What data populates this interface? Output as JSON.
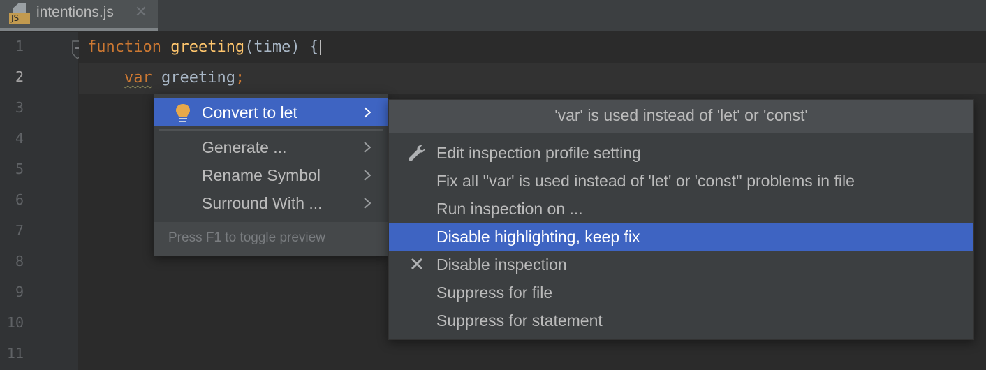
{
  "tabs": [
    {
      "label": "intentions.js",
      "icon": "js-file-icon",
      "badge": "JS",
      "active": true
    }
  ],
  "editor": {
    "line_numbers": [
      "1",
      "2",
      "3",
      "4",
      "5",
      "6",
      "7",
      "8",
      "9",
      "10",
      "11"
    ],
    "current_line": 2,
    "lines": [
      {
        "tokens": [
          {
            "text": "function",
            "kind": "keyword"
          },
          {
            "text": " ",
            "kind": "plain"
          },
          {
            "text": "greeting",
            "kind": "function"
          },
          {
            "text": "(time) {",
            "kind": "plain"
          }
        ]
      },
      {
        "tokens": [
          {
            "text": "    ",
            "kind": "plain"
          },
          {
            "text": "var",
            "kind": "keyword-warn"
          },
          {
            "text": " greeting",
            "kind": "plain"
          },
          {
            "text": ";",
            "kind": "keyword"
          }
        ]
      }
    ]
  },
  "intention_popup": {
    "items": [
      {
        "label": "Convert to let",
        "icon": "lightbulb-icon",
        "has_submenu": true,
        "selected": true
      },
      {
        "label": "Generate ...",
        "has_submenu": true,
        "selected": false
      },
      {
        "label": "Rename Symbol",
        "has_submenu": true,
        "selected": false
      },
      {
        "label": "Surround With ...",
        "has_submenu": true,
        "selected": false
      }
    ],
    "footer_hint": "Press F1 to toggle preview"
  },
  "submenu": {
    "header": "'var' is used instead of 'let' or 'const'",
    "items": [
      {
        "label": "Edit inspection profile setting",
        "icon": "wrench-icon",
        "selected": false
      },
      {
        "label": "Fix all ''var' is used instead of 'let' or 'const'' problems in file",
        "selected": false
      },
      {
        "label": "Run inspection on ...",
        "selected": false
      },
      {
        "label": "Disable highlighting, keep fix",
        "selected": true
      },
      {
        "label": "Disable inspection",
        "icon": "close-icon",
        "selected": false
      },
      {
        "label": "Suppress for file",
        "selected": false
      },
      {
        "label": "Suppress for statement",
        "selected": false
      }
    ]
  },
  "colors": {
    "selection": "#3e64c2",
    "keyword": "#cc7832",
    "function": "#ffc66d",
    "bulb": "#e8a94a"
  }
}
